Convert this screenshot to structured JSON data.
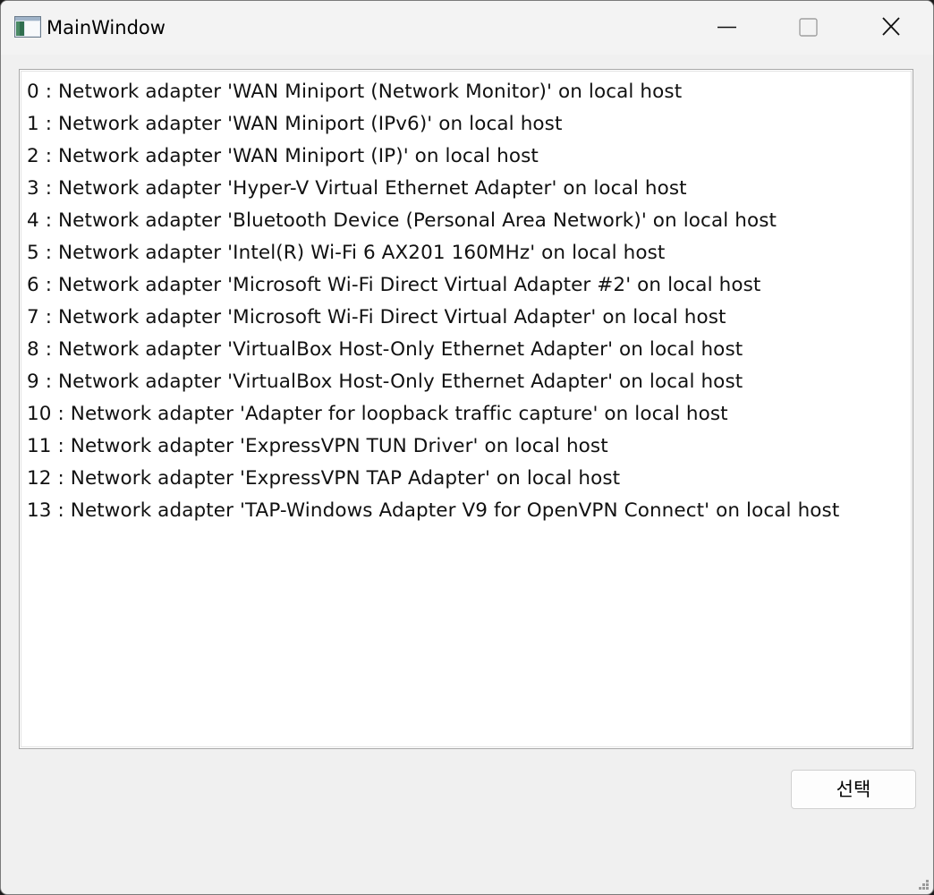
{
  "window": {
    "title": "MainWindow",
    "icon": "app-window-icon"
  },
  "caption_buttons": {
    "minimize_icon": "minimize-icon",
    "maximize_icon": "maximize-icon",
    "close_icon": "close-icon"
  },
  "adapter_list": {
    "items": [
      "0 : Network adapter 'WAN Miniport (Network Monitor)' on local host",
      "1 : Network adapter 'WAN Miniport (IPv6)' on local host",
      "2 : Network adapter 'WAN Miniport (IP)' on local host",
      "3 : Network adapter 'Hyper-V Virtual Ethernet Adapter' on local host",
      "4 : Network adapter 'Bluetooth Device (Personal Area Network)' on local host",
      "5 : Network adapter 'Intel(R) Wi-Fi 6 AX201 160MHz' on local host",
      "6 : Network adapter 'Microsoft Wi-Fi Direct Virtual Adapter #2' on local host",
      "7 : Network adapter 'Microsoft Wi-Fi Direct Virtual Adapter' on local host",
      "8 : Network adapter 'VirtualBox Host-Only Ethernet Adapter' on local host",
      "9 : Network adapter 'VirtualBox Host-Only Ethernet Adapter' on local host",
      "10 : Network adapter 'Adapter for loopback traffic capture' on local host",
      "11 : Network adapter 'ExpressVPN TUN Driver' on local host",
      "12 : Network adapter 'ExpressVPN TAP Adapter' on local host",
      "13 : Network adapter 'TAP-Windows Adapter V9 for OpenVPN Connect' on local host"
    ]
  },
  "actions": {
    "select_label": "선택"
  },
  "colors": {
    "window_bg": "#f0f0f0",
    "list_bg": "#ffffff",
    "list_border": "#a8a8a8"
  }
}
